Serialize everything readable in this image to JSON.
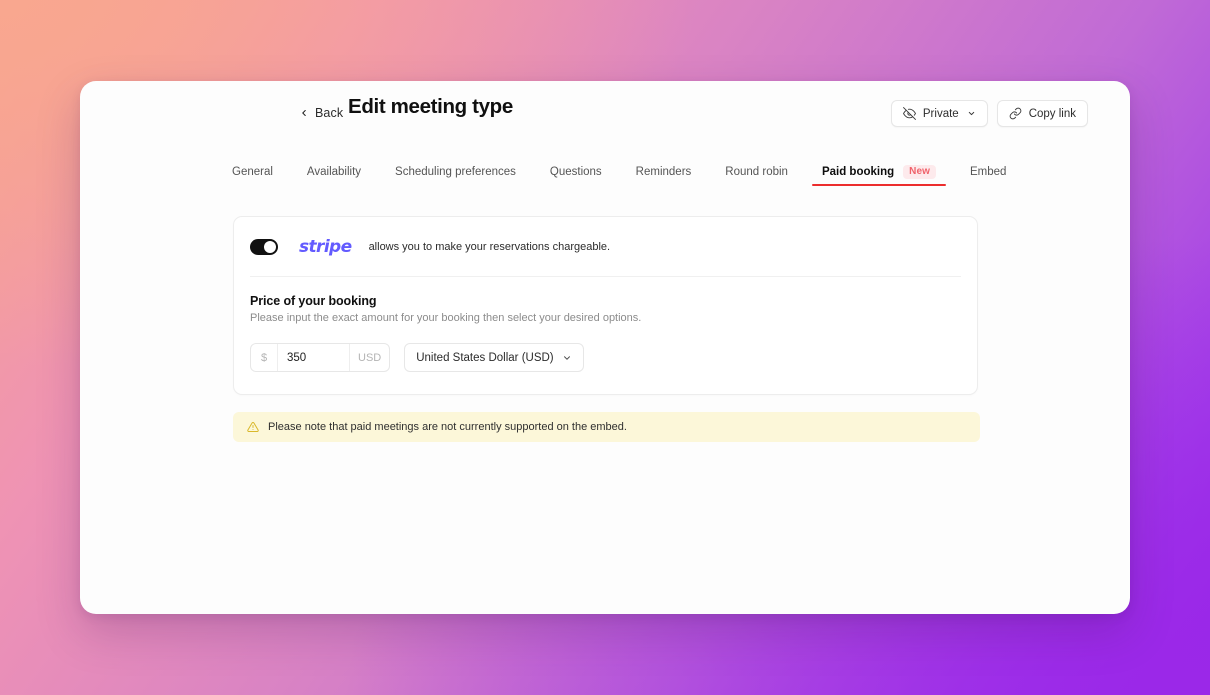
{
  "header": {
    "back_label": "Back",
    "title": "Edit meeting type",
    "visibility_label": "Private",
    "copy_link_label": "Copy link"
  },
  "tabs": [
    {
      "label": "General",
      "active": false
    },
    {
      "label": "Availability",
      "active": false
    },
    {
      "label": "Scheduling preferences",
      "active": false
    },
    {
      "label": "Questions",
      "active": false
    },
    {
      "label": "Reminders",
      "active": false
    },
    {
      "label": "Round robin",
      "active": false
    },
    {
      "label": "Paid booking",
      "active": true,
      "badge": "New"
    },
    {
      "label": "Embed",
      "active": false
    }
  ],
  "card": {
    "provider_name": "stripe",
    "provider_description": "allows you to make your reservations chargeable.",
    "toggle_state": "on",
    "price": {
      "title": "Price of your booking",
      "subtitle": "Please input the exact amount for your booking then select your desired options.",
      "currency_symbol": "$",
      "amount": "350",
      "amount_placeholder": "0",
      "currency_code": "USD",
      "currency_select_value": "United States Dollar (USD)"
    }
  },
  "alert": {
    "message": "Please note that paid meetings are not currently supported on the embed."
  },
  "colors": {
    "accent_red": "#ec2d2d",
    "badge_text": "#f0636b",
    "badge_background": "#fdeaec",
    "stripe_purple": "#635bff",
    "alert_background": "#fcf7d9",
    "toggle_on": "#111111"
  }
}
